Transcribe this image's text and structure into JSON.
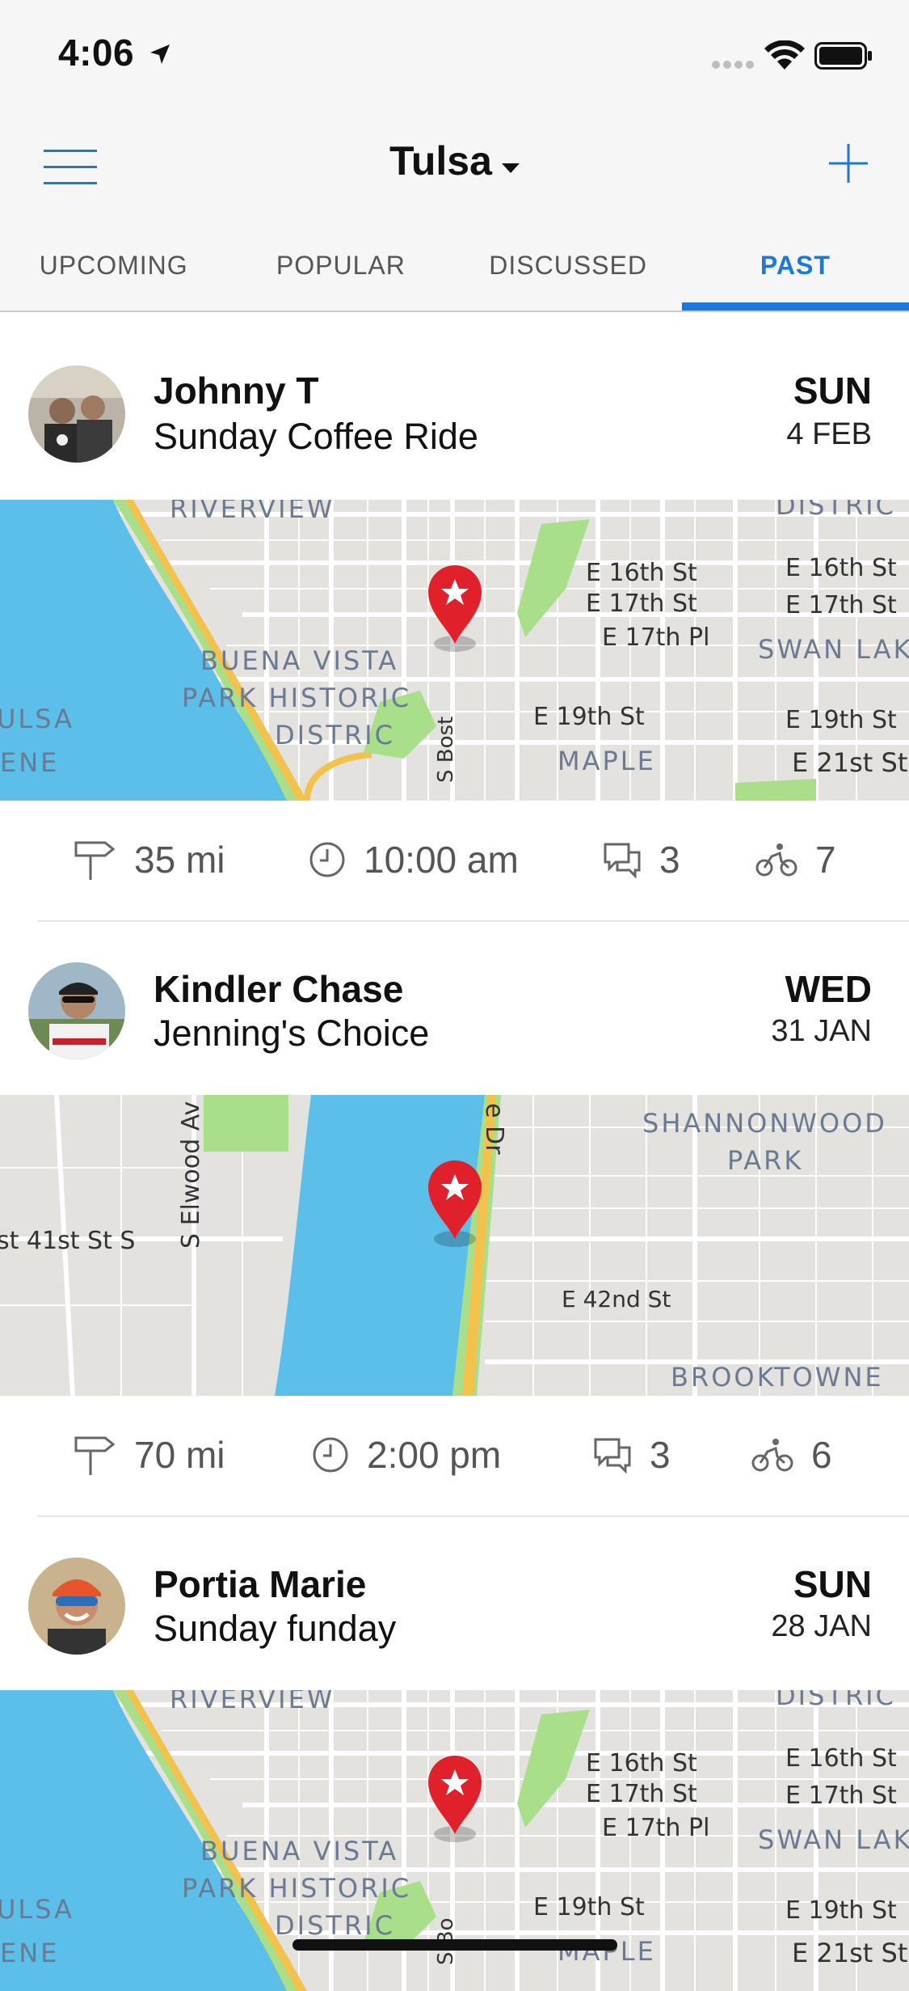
{
  "status_bar": {
    "time": "4:06"
  },
  "nav": {
    "city": "Tulsa",
    "tabs": [
      {
        "label": "UPCOMING"
      },
      {
        "label": "POPULAR"
      },
      {
        "label": "DISCUSSED"
      },
      {
        "label": "PAST",
        "active": true
      }
    ]
  },
  "colors": {
    "accent": "#1e78dc",
    "pin": "#e0202a",
    "water": "#5bbfea",
    "park": "#a9df8a",
    "road_major": "#f2c24c"
  },
  "rides": [
    {
      "rider": "Johnny T",
      "name": "Sunday Coffee Ride",
      "dow": "SUN",
      "date": "4 FEB",
      "distance": "35 mi",
      "time": "10:00 am",
      "comments": "3",
      "riders": "7",
      "map_labels": [
        "RIVERVIEW",
        "DISTRIC",
        "E 16th St",
        "E 16th St",
        "E 17th St",
        "E 17th St",
        "E 17th Pl",
        "SWAN LAK",
        "BUENA VISTA",
        "PARK HISTORIC",
        "DISTRIC",
        "ULSA",
        "E 19th St",
        "E 19th St",
        "S Bost",
        "MAPLE",
        "E 21st St",
        "ENE"
      ]
    },
    {
      "rider": "Kindler Chase",
      "name": "Jenning's Choice",
      "dow": "WED",
      "date": "31 JAN",
      "distance": "70 mi",
      "time": "2:00 pm",
      "comments": "3",
      "riders": "6",
      "map_labels": [
        "SHANNONWOOD",
        "PARK",
        "S Elwood Av",
        "st 41st St S",
        "e Dr",
        "E 42nd St",
        "BROOKTOWNE"
      ]
    },
    {
      "rider": "Portia Marie",
      "name": "Sunday funday",
      "dow": "SUN",
      "date": "28 JAN",
      "map_labels": [
        "RIVERVIEW",
        "DISTRIC",
        "E 16th St",
        "E 16th St",
        "E 17th St",
        "E 17th St",
        "E 17th Pl",
        "SWAN LAK",
        "BUENA VISTA",
        "PARK HISTORIC",
        "DISTRIC",
        "ULSA",
        "E 19th St",
        "E 19th St",
        "S Bo",
        "MAPLE",
        "E 21st St",
        "ENE"
      ]
    }
  ]
}
